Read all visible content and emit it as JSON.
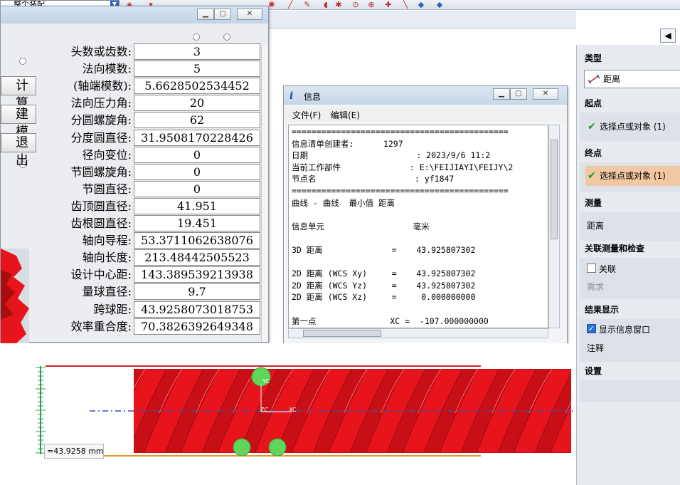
{
  "toolbar": {
    "assembly_select": "整个装配"
  },
  "param_window": {
    "side_buttons": [
      "计 算",
      "建 模",
      "退 出"
    ],
    "rows": [
      {
        "label": "头数或齿数:",
        "value": "3"
      },
      {
        "label": "法向模数:",
        "value": "5"
      },
      {
        "label": "(轴端模数):",
        "value": "5.6628502534452"
      },
      {
        "label": "法向压力角:",
        "value": "20"
      },
      {
        "label": "分圆螺旋角:",
        "value": "62"
      },
      {
        "label": "分度圆直径:",
        "value": "31.9508170228426"
      },
      {
        "label": "径向变位:",
        "value": "0"
      },
      {
        "label": "节圆螺旋角:",
        "value": "0"
      },
      {
        "label": "节圆直径:",
        "value": "0"
      },
      {
        "label": "齿顶圆直径:",
        "value": "41.951"
      },
      {
        "label": "齿根圆直径:",
        "value": "19.451"
      },
      {
        "label": "轴向导程:",
        "value": "53.3711062638076"
      },
      {
        "label": "轴向长度:",
        "value": "213.48442505523"
      },
      {
        "label": "设计中心距:",
        "value": "143.389539213938"
      },
      {
        "label": "量球直径:",
        "value": "9.7"
      },
      {
        "label": "跨球距:",
        "value": "43.9258073018753"
      },
      {
        "label": "效率重合度:",
        "value": "70.3826392649348"
      }
    ]
  },
  "info_window": {
    "title": "信息",
    "menu": [
      "文件(F)",
      "编辑(E)"
    ],
    "lines": [
      "============================================",
      "信息清单创建者:      1297",
      "日期                      : 2023/9/6 11:2",
      "当前工作部件              : E:\\FEIJIAYI\\FEIJY\\2",
      "节点名                    : yf1847",
      "============================================",
      "曲线 - 曲线  最小值 距离",
      "",
      "信息单元                  毫米",
      "",
      "3D 距离              =    43.925807302",
      "",
      "2D 距离 (WCS Xy)     =    43.925807302",
      "2D 距离 (WCS Yz)     =    43.925807302",
      "2D 距离 (WCS Xz)     =     0.000000000",
      "",
      "第一点               XC =  -107.000000000"
    ]
  },
  "measure_panel": {
    "type_head": "类型",
    "type_value": "距离",
    "start_head": "起点",
    "start_pick": "选择点或对象 (1)",
    "end_head": "终点",
    "end_pick": "选择点或对象 (1)",
    "measure_head": "测量",
    "measure_value": "距离",
    "assoc_head": "关联测量和检查",
    "assoc_label": "关联",
    "assoc_sub": "需求",
    "result_head": "结果显示",
    "show_info_label": "显示信息窗口",
    "note_label": "注释",
    "settings_head": "设置"
  },
  "graphics": {
    "dimension_label": "=43.9258 mm",
    "axis_labels": [
      "YC",
      "ZC",
      "XC"
    ],
    "worm_color": "#e8141c",
    "top_line_color": "#d0202a",
    "bottom_line_color": "#e8962e",
    "axis_color": "#3b4fb5",
    "ball_color": "#5fd65a"
  }
}
